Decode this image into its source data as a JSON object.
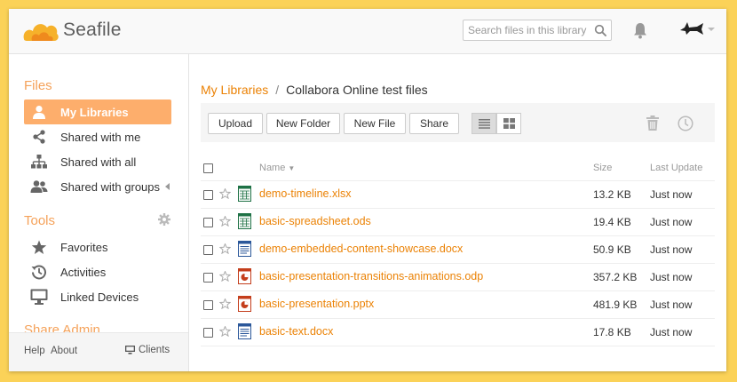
{
  "app": {
    "name": "Seafile"
  },
  "header": {
    "search_placeholder": "Search files in this library",
    "icons": {
      "search": "search-icon",
      "bell": "bell-icon",
      "avatar": "shark-avatar"
    }
  },
  "sidebar": {
    "files_title": "Files",
    "files_items": [
      {
        "label": "My Libraries",
        "icon": "user-icon",
        "active": true
      },
      {
        "label": "Shared with me",
        "icon": "share-icon",
        "active": false
      },
      {
        "label": "Shared with all",
        "icon": "org-chart-icon",
        "active": false
      },
      {
        "label": "Shared with groups",
        "icon": "group-icon",
        "active": false
      }
    ],
    "tools_title": "Tools",
    "tools_items": [
      {
        "label": "Favorites",
        "icon": "star-icon"
      },
      {
        "label": "Activities",
        "icon": "history-icon"
      },
      {
        "label": "Linked Devices",
        "icon": "monitor-icon"
      }
    ],
    "share_admin_title": "Share Admin",
    "footer": {
      "help": "Help",
      "about": "About",
      "clients": "Clients"
    }
  },
  "main": {
    "breadcrumb": {
      "root": "My Libraries",
      "separator": "/",
      "current": "Collabora Online test files"
    },
    "toolbar": {
      "upload": "Upload",
      "new_folder": "New Folder",
      "new_file": "New File",
      "share": "Share"
    },
    "table": {
      "headers": {
        "name": "Name",
        "size": "Size",
        "last_update": "Last Update"
      },
      "rows": [
        {
          "name": "demo-timeline.xlsx",
          "size": "13.2 KB",
          "updated": "Just now",
          "type": "spreadsheet"
        },
        {
          "name": "basic-spreadsheet.ods",
          "size": "19.4 KB",
          "updated": "Just now",
          "type": "spreadsheet"
        },
        {
          "name": "demo-embedded-content-showcase.docx",
          "size": "50.9 KB",
          "updated": "Just now",
          "type": "document"
        },
        {
          "name": "basic-presentation-transitions-animations.odp",
          "size": "357.2 KB",
          "updated": "Just now",
          "type": "presentation"
        },
        {
          "name": "basic-presentation.pptx",
          "size": "481.9 KB",
          "updated": "Just now",
          "type": "presentation"
        },
        {
          "name": "basic-text.docx",
          "size": "17.8 KB",
          "updated": "Just now",
          "type": "document"
        }
      ]
    }
  },
  "colors": {
    "accent": "#eb8205",
    "active_nav": "#fdae6c",
    "section_title": "#f5a25a",
    "background": "#fbd258"
  }
}
